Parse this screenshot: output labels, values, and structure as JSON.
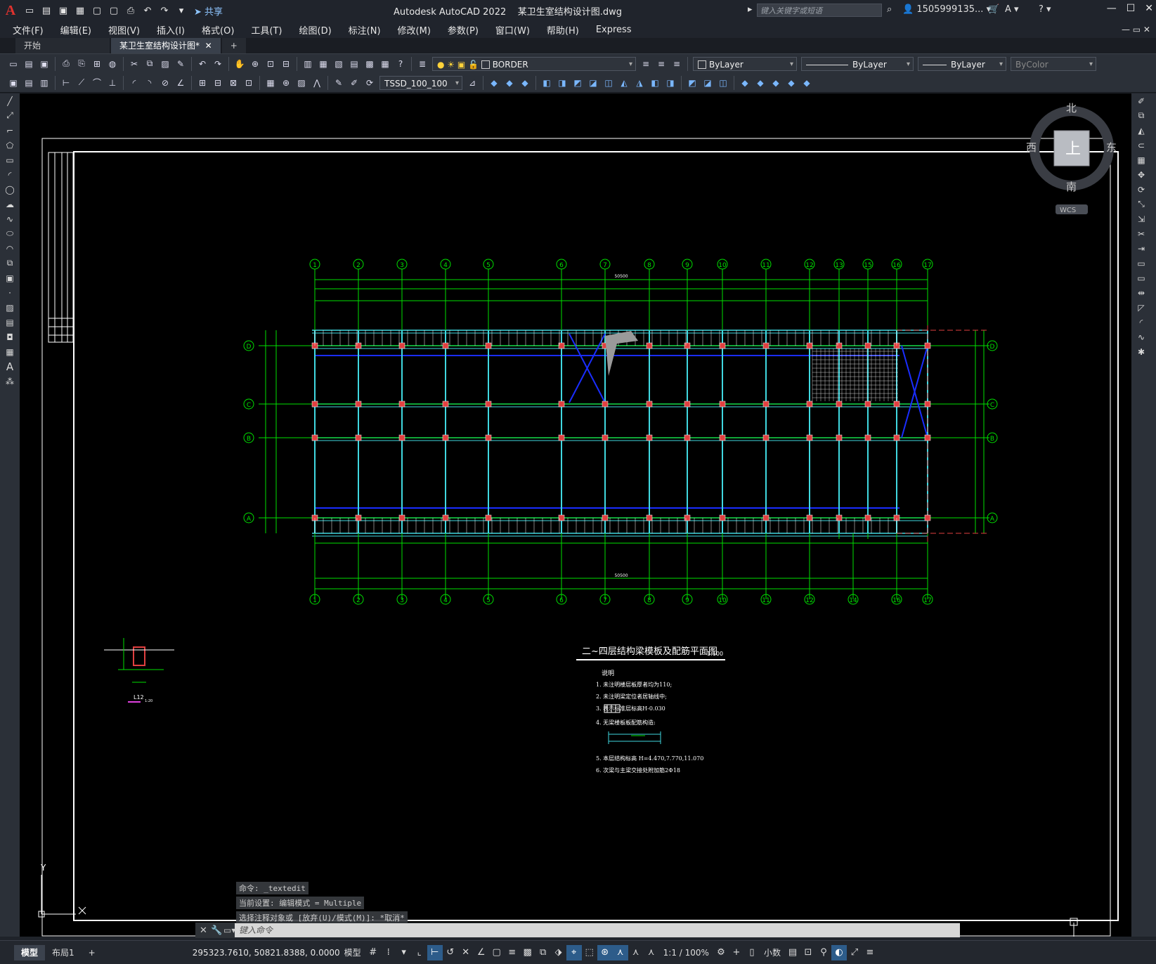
{
  "window": {
    "app_title": "Autodesk AutoCAD 2022",
    "doc_title": "某卫生室结构设计图.dwg",
    "share_label": "共享",
    "search_placeholder": "键入关键字或短语",
    "user": "1505999135...",
    "arrow": "▸"
  },
  "menu": [
    "文件(F)",
    "编辑(E)",
    "视图(V)",
    "插入(I)",
    "格式(O)",
    "工具(T)",
    "绘图(D)",
    "标注(N)",
    "修改(M)",
    "参数(P)",
    "窗口(W)",
    "帮助(H)",
    "Express"
  ],
  "tabs": {
    "start": "开始",
    "active": "某卫生室结构设计图*",
    "close": "✕",
    "add": "+"
  },
  "toolbar": {
    "layer_name": "BORDER",
    "color": "ByLayer",
    "linetype": "ByLayer",
    "lineweight": "ByLayer",
    "plotstyle": "ByColor",
    "dimstyle": "TSSD_100_100"
  },
  "viewcube": {
    "north": "北",
    "south": "南",
    "east": "东",
    "west": "西",
    "top": "上",
    "wcs": "WCS"
  },
  "drawing": {
    "title": "二~四层结构梁模板及配筋平面图",
    "scale": "1:100",
    "notes_heading": "说明",
    "notes": [
      "1. 未注明楼层板厚者均为110;",
      "2. 未注明梁定位者居轴线中;",
      "3.        表示标准层标高H-0.030",
      "4. 无梁楼板板配筋构造:",
      "5.  本层结构标高    H=4.470,7.770,11.070",
      "6. 次梁与主梁交接处附加筋2Φ18"
    ],
    "detail_label": "L12",
    "detail_scale": "1:20",
    "axes_top": [
      "1",
      "2",
      "3",
      "4",
      "5",
      "6",
      "7",
      "8",
      "9",
      "10",
      "11",
      "12",
      "13",
      "15",
      "16",
      "17"
    ],
    "axes_bottom": [
      "1",
      "2",
      "3",
      "4",
      "5",
      "6",
      "7",
      "8",
      "9",
      "10",
      "11",
      "12",
      "14",
      "16",
      "17"
    ],
    "axes_side": [
      "D",
      "C",
      "B",
      "A"
    ],
    "overall_dim": "50500",
    "ucs_y": "Y"
  },
  "command": {
    "history": [
      "命令: _textedit",
      "当前设置: 编辑模式 = Multiple",
      "选择注释对象或 [放弃(U)/模式(M)]: *取消*"
    ],
    "prompt": "键入命令"
  },
  "status": {
    "model_tab": "模型",
    "layout_tab": "布局1",
    "add": "+",
    "coords": "295323.7610, 50821.8388, 0.0000",
    "space": "模型",
    "scale": "1:1 / 100%",
    "units": "小数"
  },
  "colors": {
    "grid_green": "#00e000",
    "wall_cyan": "#40d8e0",
    "beam_blue": "#1a2dff",
    "column_red": "#e04040",
    "accent_red": "#e0322e"
  }
}
